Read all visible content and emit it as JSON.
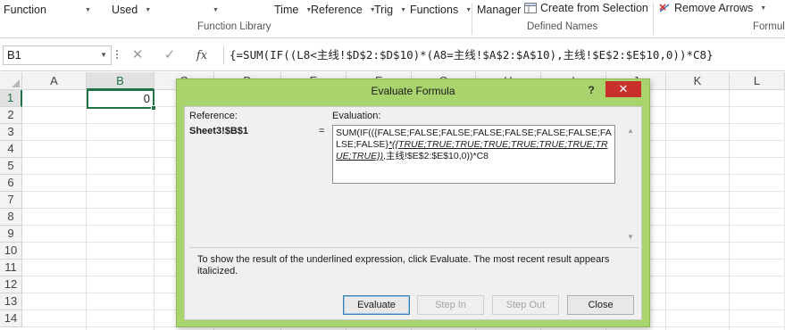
{
  "ribbon": {
    "function_library": {
      "label": "Function Library",
      "items": [
        {
          "label": "Function",
          "has_arrow": false
        },
        {
          "label": "",
          "has_arrow": true
        },
        {
          "label": "Used",
          "has_arrow": true
        },
        {
          "label": "",
          "has_arrow": true
        },
        {
          "label": "Time",
          "has_arrow": true
        },
        {
          "label": "Reference",
          "has_arrow": true
        },
        {
          "label": "Trig",
          "has_arrow": true
        },
        {
          "label": "Functions",
          "has_arrow": true
        }
      ]
    },
    "defined_names": {
      "label": "Defined Names",
      "manager": "Manager",
      "create_from_selection": "Create from Selection"
    },
    "formula_auditing": {
      "label": "Formul",
      "remove_arrows": "Remove Arrows"
    }
  },
  "formula_bar": {
    "name_box": "B1",
    "cancel_icon": "✕",
    "enter_icon": "✓",
    "fx_label": "fx",
    "formula": "{=SUM(IF((L8<主线!$D$2:$D$10)*(A8=主线!$A$2:$A$10),主线!$E$2:$E$10,0))*C8}"
  },
  "grid": {
    "columns": [
      "A",
      "B",
      "C",
      "D",
      "E",
      "F",
      "G",
      "H",
      "I",
      "J",
      "K",
      "L"
    ],
    "rows": [
      "1",
      "2",
      "3",
      "4",
      "5",
      "6",
      "7",
      "8",
      "9",
      "10",
      "11",
      "12",
      "13",
      "14"
    ],
    "active_column": "B",
    "active_row": "1",
    "active_cell_value": "0"
  },
  "dialog": {
    "title": "Evaluate Formula",
    "help": "?",
    "close": "✕",
    "reference_label": "Reference:",
    "reference_value": "Sheet3!$B$1",
    "equals": "=",
    "evaluation_label": "Evaluation:",
    "evaluation_text_before": "SUM(IF(({FALSE;FALSE;FALSE;FALSE;FALSE;FALSE;FALSE;FALSE;FALSE}",
    "evaluation_text_underlined": "*({TRUE;TRUE;TRUE;TRUE;TRUE;TRUE;TRUE;TRUE;TRUE})",
    "evaluation_text_after": ",主线!$E$2:$E$10,0))*C8",
    "help_text": "To show the result of the underlined expression, click Evaluate.  The most recent result appears italicized.",
    "buttons": {
      "evaluate": "Evaluate",
      "step_in": "Step In",
      "step_out": "Step Out",
      "close": "Close"
    }
  },
  "colors": {
    "accent_green": "#217346",
    "dialog_frame": "#a8d36d",
    "close_red": "#c9302c"
  }
}
